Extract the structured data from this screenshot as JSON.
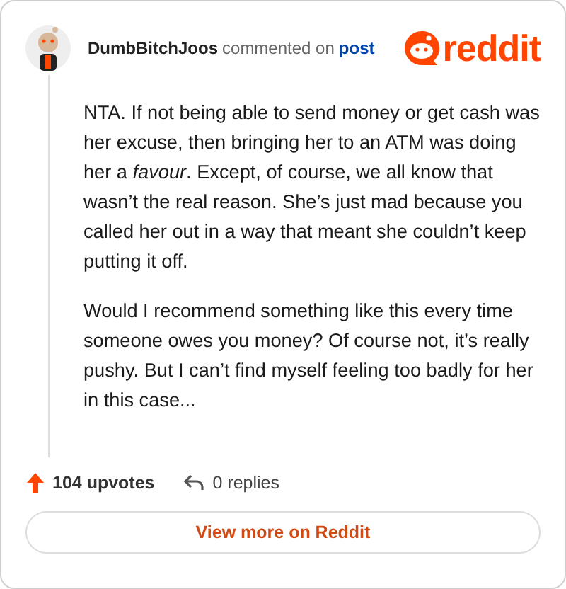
{
  "header": {
    "author": "DumbBitchJoos",
    "action": "commented on",
    "link": "post",
    "logo": "reddit"
  },
  "comment": {
    "paragraphs": [
      "NTA. If not being able to send money or get cash was her excuse, then bringing her to an ATM was doing her a *favour*. Except, of course, we all know that wasn’t the real reason. She’s just mad because you called her out in a way that meant she couldn’t keep putting it off.",
      "Would I recommend something like this every time someone owes you money? Of course not, it’s really pushy. But I can’t find myself feeling too badly for her in this case..."
    ]
  },
  "stats": {
    "upvotes": "104 upvotes",
    "replies": "0 replies"
  },
  "button": "View more on Reddit"
}
